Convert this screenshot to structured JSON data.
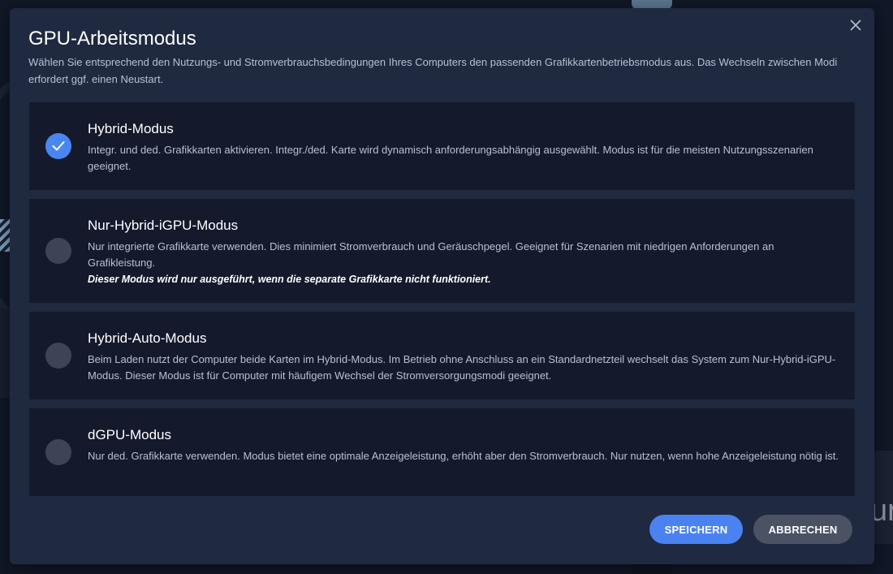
{
  "dialog": {
    "title": "GPU-Arbeitsmodus",
    "description": "Wählen Sie entsprechend den Nutzungs- und Stromverbrauchsbedingungen Ihres Computers den passenden Grafikkartenbetriebsmodus aus. Das Wechseln zwischen Modi erfordert ggf. einen Neustart.",
    "close_icon": "close-icon"
  },
  "options": [
    {
      "title": "Hybrid-Modus",
      "description": "Integr. und ded. Grafikkarten aktivieren. Integr./ded. Karte wird dynamisch anforderungsabhängig ausgewählt. Modus ist für die meisten Nutzungsszenarien geeignet.",
      "selected": true
    },
    {
      "title": "Nur-Hybrid-iGPU-Modus",
      "description": "Nur integrierte Grafikkarte verwenden. Dies minimiert Stromverbrauch und Geräuschpegel. Geeignet für Szenarien mit niedrigen Anforderungen an Grafikleistung.",
      "note": "Dieser Modus wird nur ausgeführt, wenn die separate Grafikkarte nicht funktioniert.",
      "selected": false
    },
    {
      "title": "Hybrid-Auto-Modus",
      "description": "Beim Laden nutzt der Computer beide Karten im Hybrid-Modus. Im Betrieb ohne Anschluss an ein Standardnetzteil wechselt das System zum Nur-Hybrid-iGPU-Modus. Dieser Modus ist für Computer mit häufigem Wechsel der Stromversorgungsmodi geeignet.",
      "selected": false
    },
    {
      "title": "dGPU-Modus",
      "description": "Nur ded. Grafikkarte verwenden. Modus bietet eine optimale Anzeigeleistung, erhöht aber den Stromverbrauch. Nur nutzen, wenn hohe Anzeigeleistung nötig ist.",
      "selected": false
    }
  ],
  "buttons": {
    "save_label": "SPEICHERN",
    "cancel_label": "ABBRECHEN"
  },
  "background": {
    "partial_text": "ur"
  },
  "colors": {
    "accent": "#4a82f2",
    "dialog_bg": "#1f2940",
    "option_bg": "#141a2c"
  }
}
